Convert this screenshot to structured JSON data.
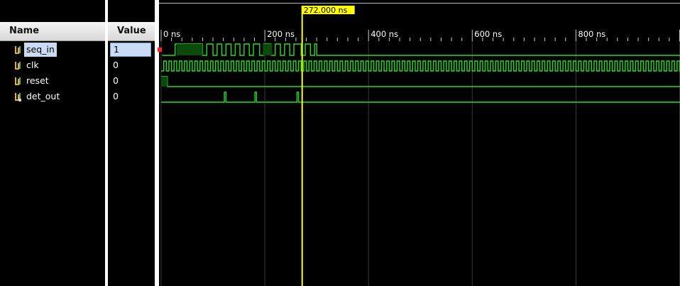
{
  "columns": {
    "name": "Name",
    "value": "Value"
  },
  "signals": [
    {
      "name": "seq_in",
      "value": "1",
      "selected": true,
      "icon": "signal-icon"
    },
    {
      "name": "clk",
      "value": "0",
      "selected": false,
      "icon": "signal-icon"
    },
    {
      "name": "reset",
      "value": "0",
      "selected": false,
      "icon": "signal-icon"
    },
    {
      "name": "det_out",
      "value": "0",
      "selected": false,
      "icon": "output-signal-icon"
    }
  ],
  "timeline": {
    "tick_labels": [
      "0 ns",
      "200 ns",
      "400 ns",
      "600 ns",
      "800 ns"
    ],
    "cursor_label": "272.000 ns",
    "cursor_time_ns": 272
  },
  "colors": {
    "wave": "#22dd22",
    "wave_fill": "#0b4a0b",
    "cursor": "#ffff00",
    "grid": "#3a3a3a",
    "selection": "#c9dcf3",
    "uninit": "#ff2020"
  }
}
